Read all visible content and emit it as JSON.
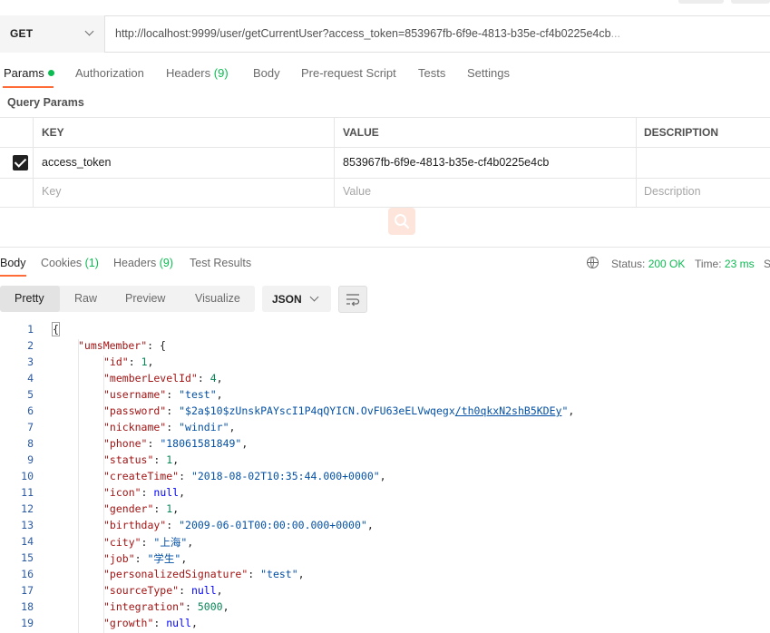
{
  "request": {
    "method": "GET",
    "url": "http://localhost:9999/user/getCurrentUser?access_token=853967fb-6f9e-4813-b35e-cf4b0225e4cb",
    "url_ellipsis": "..."
  },
  "request_tabs": [
    {
      "label": "Params",
      "badge": ""
    },
    {
      "label": "Authorization",
      "badge": ""
    },
    {
      "label": "Headers",
      "badge": "(9)"
    },
    {
      "label": "Body",
      "badge": ""
    },
    {
      "label": "Pre-request Script",
      "badge": ""
    },
    {
      "label": "Tests",
      "badge": ""
    },
    {
      "label": "Settings",
      "badge": ""
    }
  ],
  "query_params": {
    "title": "Query Params",
    "headers": {
      "key": "KEY",
      "value": "VALUE",
      "description": "DESCRIPTION"
    },
    "rows": [
      {
        "checked": true,
        "key": "access_token",
        "value": "853967fb-6f9e-4813-b35e-cf4b0225e4cb",
        "description": ""
      }
    ],
    "placeholders": {
      "key": "Key",
      "value": "Value",
      "description": "Description"
    }
  },
  "response_tabs": [
    {
      "label": "Body",
      "badge": ""
    },
    {
      "label": "Cookies",
      "badge": "(1)"
    },
    {
      "label": "Headers",
      "badge": "(9)"
    },
    {
      "label": "Test Results",
      "badge": ""
    }
  ],
  "response_status": {
    "status_label": "Status:",
    "status_value": "200 OK",
    "time_label": "Time:",
    "time_value": "23 ms",
    "size_label_partial": "S"
  },
  "view_modes": [
    "Pretty",
    "Raw",
    "Preview",
    "Visualize"
  ],
  "format": "JSON",
  "code_lines": [
    {
      "n": "1",
      "indent": 0,
      "parts": [
        [
          "p",
          "{"
        ]
      ]
    },
    {
      "n": "2",
      "indent": 1,
      "parts": [
        [
          "k",
          "\"umsMember\""
        ],
        [
          "p",
          ": {"
        ]
      ]
    },
    {
      "n": "3",
      "indent": 2,
      "parts": [
        [
          "k",
          "\"id\""
        ],
        [
          "p",
          ": "
        ],
        [
          "n",
          "1"
        ],
        [
          "p",
          ","
        ]
      ]
    },
    {
      "n": "4",
      "indent": 2,
      "parts": [
        [
          "k",
          "\"memberLevelId\""
        ],
        [
          "p",
          ": "
        ],
        [
          "n",
          "4"
        ],
        [
          "p",
          ","
        ]
      ]
    },
    {
      "n": "5",
      "indent": 2,
      "parts": [
        [
          "k",
          "\"username\""
        ],
        [
          "p",
          ": "
        ],
        [
          "s",
          "\"test\""
        ],
        [
          "p",
          ","
        ]
      ]
    },
    {
      "n": "6",
      "indent": 2,
      "parts": [
        [
          "k",
          "\"password\""
        ],
        [
          "p",
          ": "
        ],
        [
          "s",
          "\"$2a$10$zUnskPAYscI1P4qQYICN.OvFU63eELVwqegx"
        ],
        [
          "sl",
          "/th0qkxN2shB5KDEy"
        ],
        [
          "s",
          "\""
        ],
        [
          "p",
          ","
        ]
      ]
    },
    {
      "n": "7",
      "indent": 2,
      "parts": [
        [
          "k",
          "\"nickname\""
        ],
        [
          "p",
          ": "
        ],
        [
          "s",
          "\"windir\""
        ],
        [
          "p",
          ","
        ]
      ]
    },
    {
      "n": "8",
      "indent": 2,
      "parts": [
        [
          "k",
          "\"phone\""
        ],
        [
          "p",
          ": "
        ],
        [
          "s",
          "\"18061581849\""
        ],
        [
          "p",
          ","
        ]
      ]
    },
    {
      "n": "9",
      "indent": 2,
      "parts": [
        [
          "k",
          "\"status\""
        ],
        [
          "p",
          ": "
        ],
        [
          "n",
          "1"
        ],
        [
          "p",
          ","
        ]
      ]
    },
    {
      "n": "10",
      "indent": 2,
      "parts": [
        [
          "k",
          "\"createTime\""
        ],
        [
          "p",
          ": "
        ],
        [
          "s",
          "\"2018-08-02T10:35:44.000+0000\""
        ],
        [
          "p",
          ","
        ]
      ]
    },
    {
      "n": "11",
      "indent": 2,
      "parts": [
        [
          "k",
          "\"icon\""
        ],
        [
          "p",
          ": "
        ],
        [
          "kw",
          "null"
        ],
        [
          "p",
          ","
        ]
      ]
    },
    {
      "n": "12",
      "indent": 2,
      "parts": [
        [
          "k",
          "\"gender\""
        ],
        [
          "p",
          ": "
        ],
        [
          "n",
          "1"
        ],
        [
          "p",
          ","
        ]
      ]
    },
    {
      "n": "13",
      "indent": 2,
      "parts": [
        [
          "k",
          "\"birthday\""
        ],
        [
          "p",
          ": "
        ],
        [
          "s",
          "\"2009-06-01T00:00:00.000+0000\""
        ],
        [
          "p",
          ","
        ]
      ]
    },
    {
      "n": "14",
      "indent": 2,
      "parts": [
        [
          "k",
          "\"city\""
        ],
        [
          "p",
          ": "
        ],
        [
          "s",
          "\"上海\""
        ],
        [
          "p",
          ","
        ]
      ]
    },
    {
      "n": "15",
      "indent": 2,
      "parts": [
        [
          "k",
          "\"job\""
        ],
        [
          "p",
          ": "
        ],
        [
          "s",
          "\"学生\""
        ],
        [
          "p",
          ","
        ]
      ]
    },
    {
      "n": "16",
      "indent": 2,
      "parts": [
        [
          "k",
          "\"personalizedSignature\""
        ],
        [
          "p",
          ": "
        ],
        [
          "s",
          "\"test\""
        ],
        [
          "p",
          ","
        ]
      ]
    },
    {
      "n": "17",
      "indent": 2,
      "parts": [
        [
          "k",
          "\"sourceType\""
        ],
        [
          "p",
          ": "
        ],
        [
          "kw",
          "null"
        ],
        [
          "p",
          ","
        ]
      ]
    },
    {
      "n": "18",
      "indent": 2,
      "parts": [
        [
          "k",
          "\"integration\""
        ],
        [
          "p",
          ": "
        ],
        [
          "n",
          "5000"
        ],
        [
          "p",
          ","
        ]
      ]
    },
    {
      "n": "19",
      "indent": 2,
      "parts": [
        [
          "k",
          "\"growth\""
        ],
        [
          "p",
          ": "
        ],
        [
          "kw",
          "null"
        ],
        [
          "p",
          ","
        ]
      ]
    }
  ],
  "colors": {
    "accent": "#ff6c37",
    "success": "#0cbb52"
  }
}
